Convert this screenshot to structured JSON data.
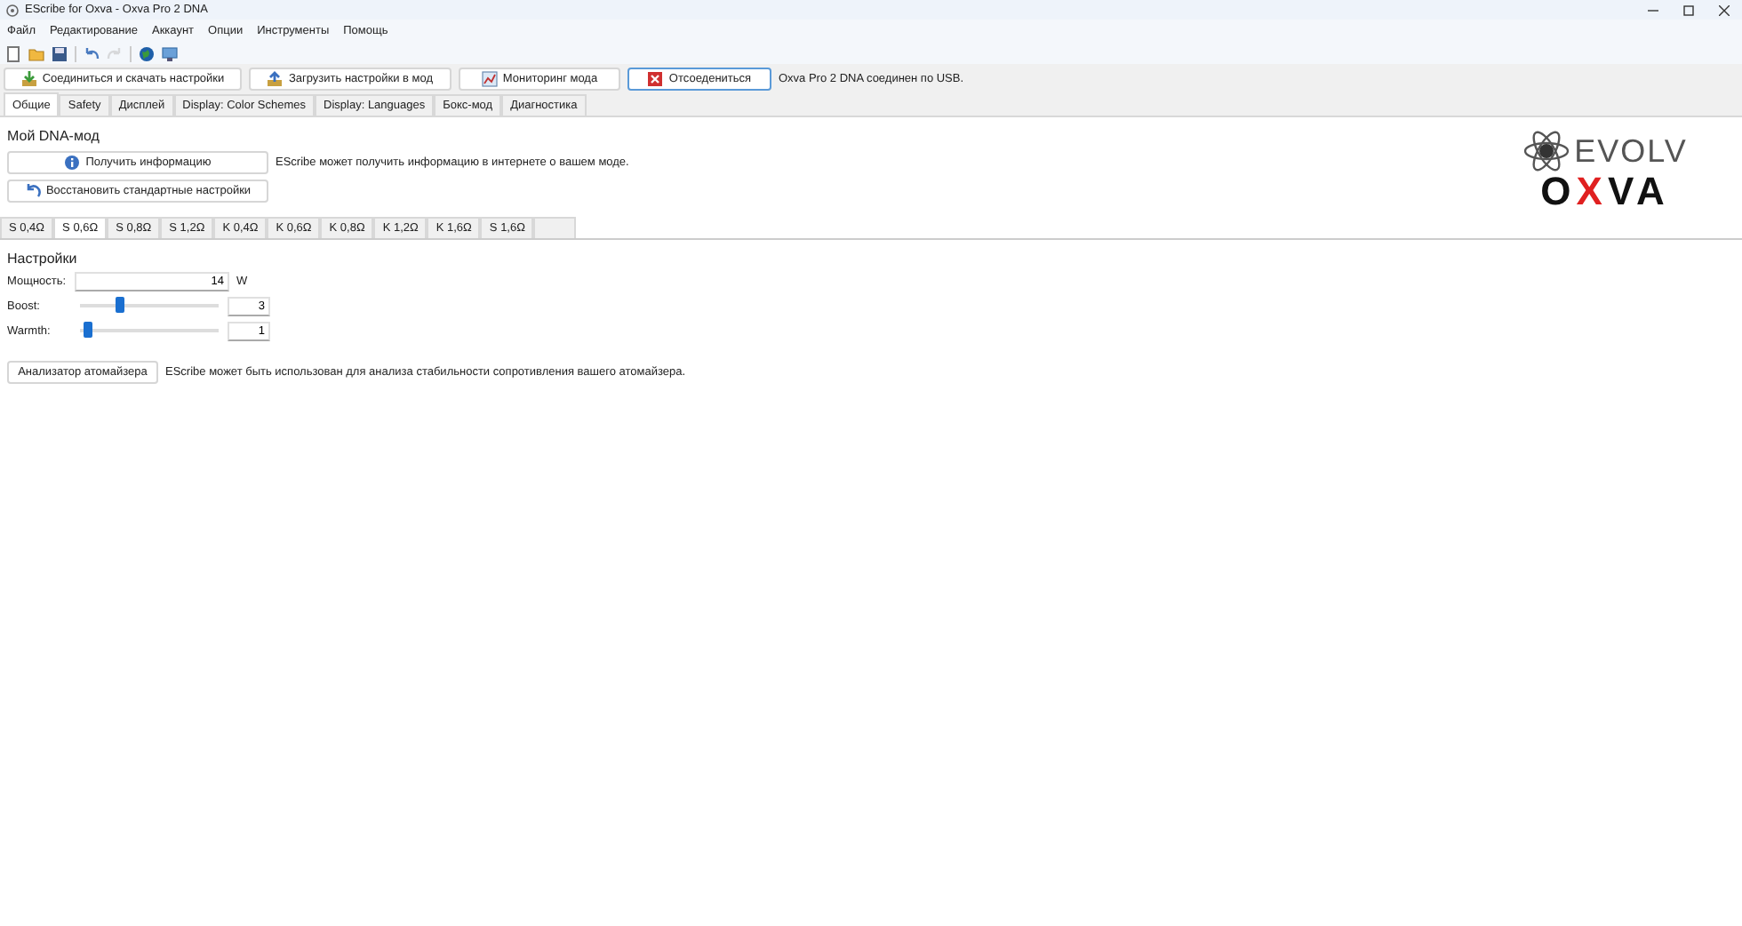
{
  "window": {
    "title": "EScribe for Oxva - Oxva Pro 2 DNA"
  },
  "menu": [
    "Файл",
    "Редактирование",
    "Аккаунт",
    "Опции",
    "Инструменты",
    "Помощь"
  ],
  "toolbar": [
    {
      "kind": "new",
      "disabled": false
    },
    {
      "kind": "open",
      "disabled": false
    },
    {
      "kind": "save",
      "disabled": false
    },
    {
      "kind": "undo",
      "disabled": false
    },
    {
      "kind": "redo",
      "disabled": true
    },
    {
      "kind": "globe",
      "disabled": false
    },
    {
      "kind": "monitor",
      "disabled": false
    }
  ],
  "action_buttons": [
    {
      "label": "Соединиться и скачать настройки",
      "selected": false
    },
    {
      "label": "Загрузить настройки в мод",
      "selected": false
    },
    {
      "label": "Мониторинг мода",
      "selected": false
    },
    {
      "label": "Отсоедениться",
      "selected": true
    }
  ],
  "status": "Oxva Pro 2 DNA соединен по USB.",
  "tabs": [
    {
      "label": "Общие",
      "selected": true
    },
    {
      "label": "Safety",
      "selected": false
    },
    {
      "label": "Дисплей",
      "selected": false
    },
    {
      "label": "Display: Color Schemes",
      "selected": false
    },
    {
      "label": "Display: Languages",
      "selected": false
    },
    {
      "label": "Бокс-мод",
      "selected": false
    },
    {
      "label": "Диагностика",
      "selected": false
    }
  ],
  "section_title": "Мой DNA-мод",
  "info_buttons": [
    {
      "label": "Получить информацию",
      "description": "EScribe может получить информацию в интернете о вашем моде."
    },
    {
      "label": "Восстановить стандартные настройки"
    }
  ],
  "coil_tabs": [
    {
      "label": "S 0,4Ω",
      "selected": false
    },
    {
      "label": "S 0,6Ω",
      "selected": true
    },
    {
      "label": "S 0,8Ω",
      "selected": false
    },
    {
      "label": "S 1,2Ω",
      "selected": false
    },
    {
      "label": "K 0,4Ω",
      "selected": false
    },
    {
      "label": "K 0,6Ω",
      "selected": false
    },
    {
      "label": "K 0,8Ω",
      "selected": false
    },
    {
      "label": "K 1,2Ω",
      "selected": false
    },
    {
      "label": "K 1,6Ω",
      "selected": false
    },
    {
      "label": "S 1,6Ω",
      "selected": false
    }
  ],
  "settings": {
    "title": "Настройки",
    "rows": [
      {
        "kind": "input",
        "label": "Мощность:",
        "value": "14",
        "unit": "W"
      },
      {
        "kind": "slider",
        "label": "Boost:",
        "level": 0.28,
        "value": "3"
      },
      {
        "kind": "slider",
        "label": "Warmth:",
        "level": 0.03,
        "value": "1"
      }
    ]
  },
  "analyzer": {
    "label": "Анализатор атомайзера",
    "description": "EScribe может быть использован для анализа стабильности сопротивления вашего атомайзера."
  },
  "logo": {
    "top": "EVOLV",
    "bottom": "OXVA"
  }
}
